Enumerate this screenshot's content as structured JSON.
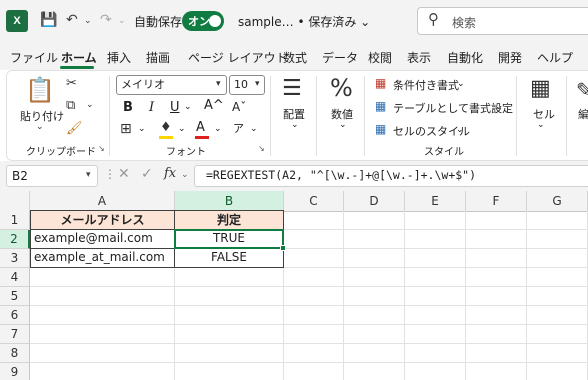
{
  "titlebar": {
    "app_badge": "X",
    "autosave_label": "自動保存",
    "autosave_state": "オン",
    "doc_title": "sample… • 保存済み ⌄",
    "search_placeholder": "検索"
  },
  "tabs": [
    "ファイル",
    "ホーム",
    "挿入",
    "描画",
    "ページ レイアウト",
    "数式",
    "データ",
    "校閲",
    "表示",
    "自動化",
    "開発",
    "ヘルプ"
  ],
  "ribbon": {
    "clipboard": {
      "paste_label": "貼り付け",
      "group_label": "クリップボード"
    },
    "font": {
      "font_name": "メイリオ",
      "font_size": "10",
      "group_label": "フォント",
      "bold": "B",
      "italic": "I",
      "underline": "U",
      "grow": "A^",
      "shrink": "Aˇ"
    },
    "alignment": {
      "label": "配置"
    },
    "number": {
      "label": "数値",
      "icon": "%"
    },
    "styles": {
      "conditional": "条件付き書式",
      "table": "テーブルとして書式設定",
      "cell_styles": "セルのスタイル",
      "group_label": "スタイル"
    },
    "cells": {
      "label": "セル"
    },
    "editing": {
      "label": "編"
    }
  },
  "formula": {
    "namebox": "B2",
    "text": "=REGEXTEST(A2, \"^[\\w.-]+@[\\w.-]+.\\w+$\")"
  },
  "grid": {
    "columns": [
      "A",
      "B",
      "C",
      "D",
      "E",
      "F",
      "G"
    ],
    "rows": [
      "1",
      "2",
      "3",
      "4",
      "5",
      "6",
      "7",
      "8",
      "9"
    ],
    "header": [
      "メールアドレス",
      "判定"
    ],
    "data": [
      [
        "example@mail.com",
        "TRUE"
      ],
      [
        "example_at_mail.com",
        "FALSE"
      ]
    ],
    "active_cell": "B2"
  },
  "colors": {
    "accent": "#107c41",
    "header_fill": "#fce4d6"
  }
}
